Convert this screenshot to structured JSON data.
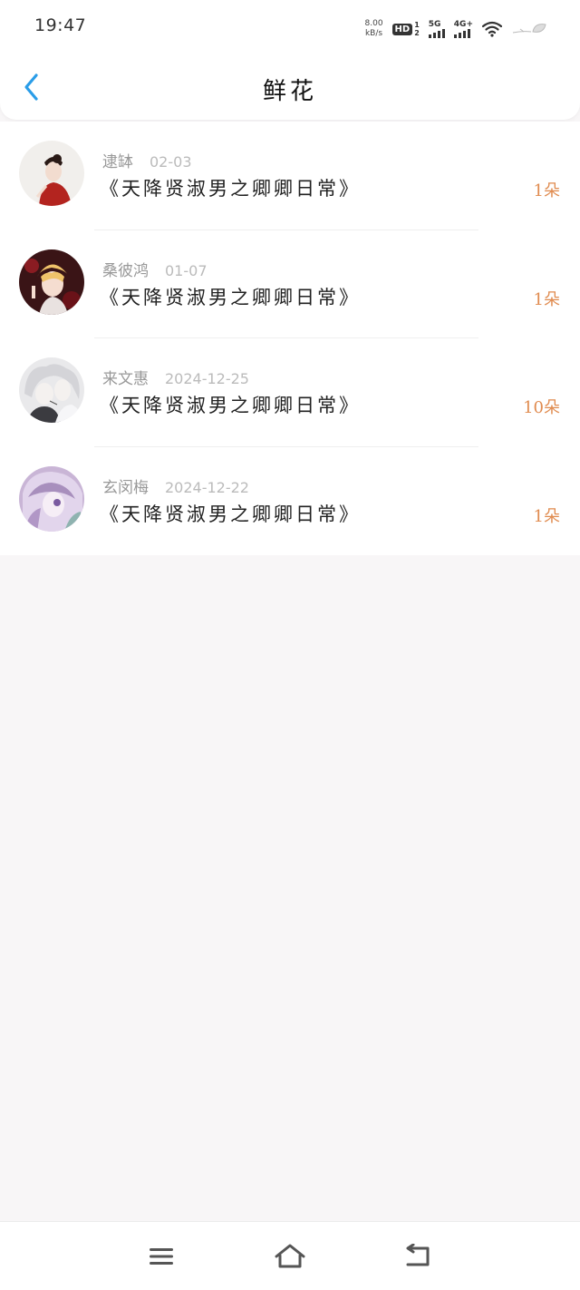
{
  "status_bar": {
    "time": "19:47",
    "net_speed_value": "8.00",
    "net_speed_unit": "kB/s",
    "hd_label": "HD",
    "hd_sim": "1",
    "hd_sim2": "2",
    "sig1_label": "5G",
    "sig2_label": "4G+"
  },
  "header": {
    "title": "鲜花"
  },
  "flowers": [
    {
      "name": "逮缽",
      "date": "02-03",
      "book": "《天降贤淑男之卿卿日常》",
      "count": "1朵"
    },
    {
      "name": "桑彼鸿",
      "date": "01-07",
      "book": "《天降贤淑男之卿卿日常》",
      "count": "1朵"
    },
    {
      "name": "来文惠",
      "date": "2024-12-25",
      "book": "《天降贤淑男之卿卿日常》",
      "count": "10朵"
    },
    {
      "name": "玄闵梅",
      "date": "2024-12-22",
      "book": "《天降贤淑男之卿卿日常》",
      "count": "1朵"
    }
  ],
  "colors": {
    "accent": "#2a9de8",
    "count": "#e08b4f",
    "background": "#f8f6f7"
  },
  "icons": {
    "back": "chevron-left-icon",
    "menu": "menu-icon",
    "home": "home-icon",
    "back_nav": "return-icon"
  }
}
